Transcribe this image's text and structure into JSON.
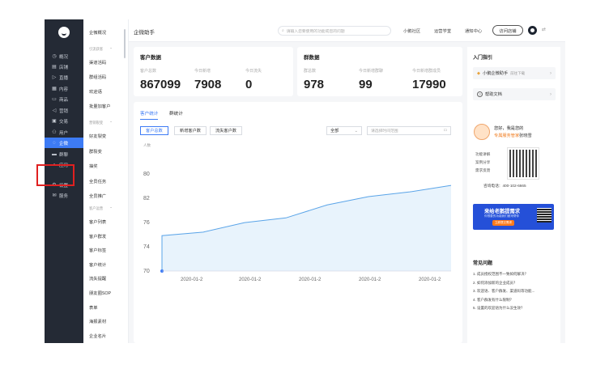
{
  "rail": {
    "items": [
      {
        "icon": "◷",
        "label": "概况",
        "name": "overview"
      },
      {
        "icon": "▤",
        "label": "店铺",
        "name": "shop"
      },
      {
        "icon": "▷",
        "label": "直播",
        "name": "live"
      },
      {
        "icon": "▦",
        "label": "内容",
        "name": "content"
      },
      {
        "icon": "▭",
        "label": "商品",
        "name": "goods"
      },
      {
        "icon": "◁",
        "label": "营销",
        "name": "marketing"
      },
      {
        "icon": "▣",
        "label": "交易",
        "name": "trade"
      },
      {
        "icon": "⚇",
        "label": "用户",
        "name": "user"
      },
      {
        "icon": "◌",
        "label": "企微",
        "name": "wecom"
      },
      {
        "icon": "▬",
        "label": "群聊",
        "name": "group"
      },
      {
        "icon": "▪",
        "label": "应用",
        "name": "app"
      },
      {
        "icon": "⚙",
        "label": "设置",
        "name": "settings"
      },
      {
        "icon": "✉",
        "label": "服务",
        "name": "service"
      }
    ]
  },
  "submenu": {
    "top": "企微概况",
    "groups": [
      {
        "title": "引流获客",
        "arrow": "⌃"
      },
      {
        "title": "营销裂变",
        "arrow": "⌃"
      },
      {
        "title": "客户运营",
        "arrow": "⌃"
      }
    ],
    "items_a": [
      "渠道活码",
      "群组活码",
      "欢迎语",
      "批量加客户"
    ],
    "items_b": [
      "好友裂变",
      "群裂变",
      "抽奖",
      "全员任务",
      "全员推广"
    ],
    "items_c": [
      "客户列表",
      "客户群发",
      "客户标签",
      "客户统计",
      "流失提醒",
      "朋友圈SOP",
      "表单",
      "海报素材",
      "企业名片"
    ]
  },
  "topbar": {
    "title": "企微助手",
    "search_placeholder": "请输入您要使用的功能或您的问题",
    "nav": [
      "小鹅社区",
      "运营学堂",
      "通知中心"
    ],
    "visit": "访问店铺",
    "search_icon": "⌕"
  },
  "customer": {
    "title": "客户数据",
    "labels": [
      "客户总数",
      "今日新增",
      "今日流失"
    ],
    "values": [
      "867099",
      "7908",
      "0"
    ]
  },
  "groupdata": {
    "title": "群数据",
    "labels": [
      "群总数",
      "今日新增群聊",
      "今日新增群成员"
    ],
    "values": [
      "978",
      "99",
      "17990"
    ]
  },
  "tabs": [
    "客户统计",
    "群统计"
  ],
  "segments": [
    "客户总数",
    "新增客户数",
    "流失客户数"
  ],
  "filter": {
    "select": "全部",
    "caret": "⌄",
    "date_placeholder": "请选择时间范围",
    "calendar": "▭"
  },
  "chart_data": {
    "type": "area",
    "ylabel": "人数",
    "yticks": [
      "70",
      "74",
      "76",
      "82",
      "80"
    ],
    "ytick_values": [
      70,
      74,
      76,
      82,
      80
    ],
    "ylim": [
      70,
      90
    ],
    "xticks": [
      "2020-01-2",
      "2020-01-2",
      "2020-01-2",
      "2020-01-2",
      "2020-01-2"
    ],
    "x": [
      0,
      1,
      2,
      3,
      4,
      5,
      6,
      7
    ],
    "values": [
      76,
      76.6,
      78.2,
      79,
      81.2,
      82.6,
      83.4,
      84.5
    ],
    "start_value": 70,
    "color": "#5aa4e8",
    "fill": "#e8f3fc",
    "grid": false
  },
  "sidebar": {
    "guide_title": "入门指引",
    "assistant": "小鹅企微助手",
    "assistant_link": "前往下载",
    "help": "帮助文档",
    "greeting_1": "您好，我是您的",
    "greeting_2": "专属服务管家",
    "greeting_3": "张晓雪",
    "bullets": [
      "功能讲解",
      "案例分享",
      "需求反馈"
    ],
    "phone": "咨询电话：400-102-6665",
    "banner_title": "来给老鹅提需求",
    "banner_sub": "你想要的功能我们都来帮你",
    "banner_btn": "立即提交需求",
    "faq_title": "常见问题",
    "faqs": [
      "1. 成员授权范围不一致如何解决？",
      "2. 如何添加新的企业成员？",
      "3. 欢迎语、客户群发、渠道码等功能...",
      "4. 客户群发有什么限制？",
      "5. 设置的欢迎语为什么没生效？"
    ]
  }
}
